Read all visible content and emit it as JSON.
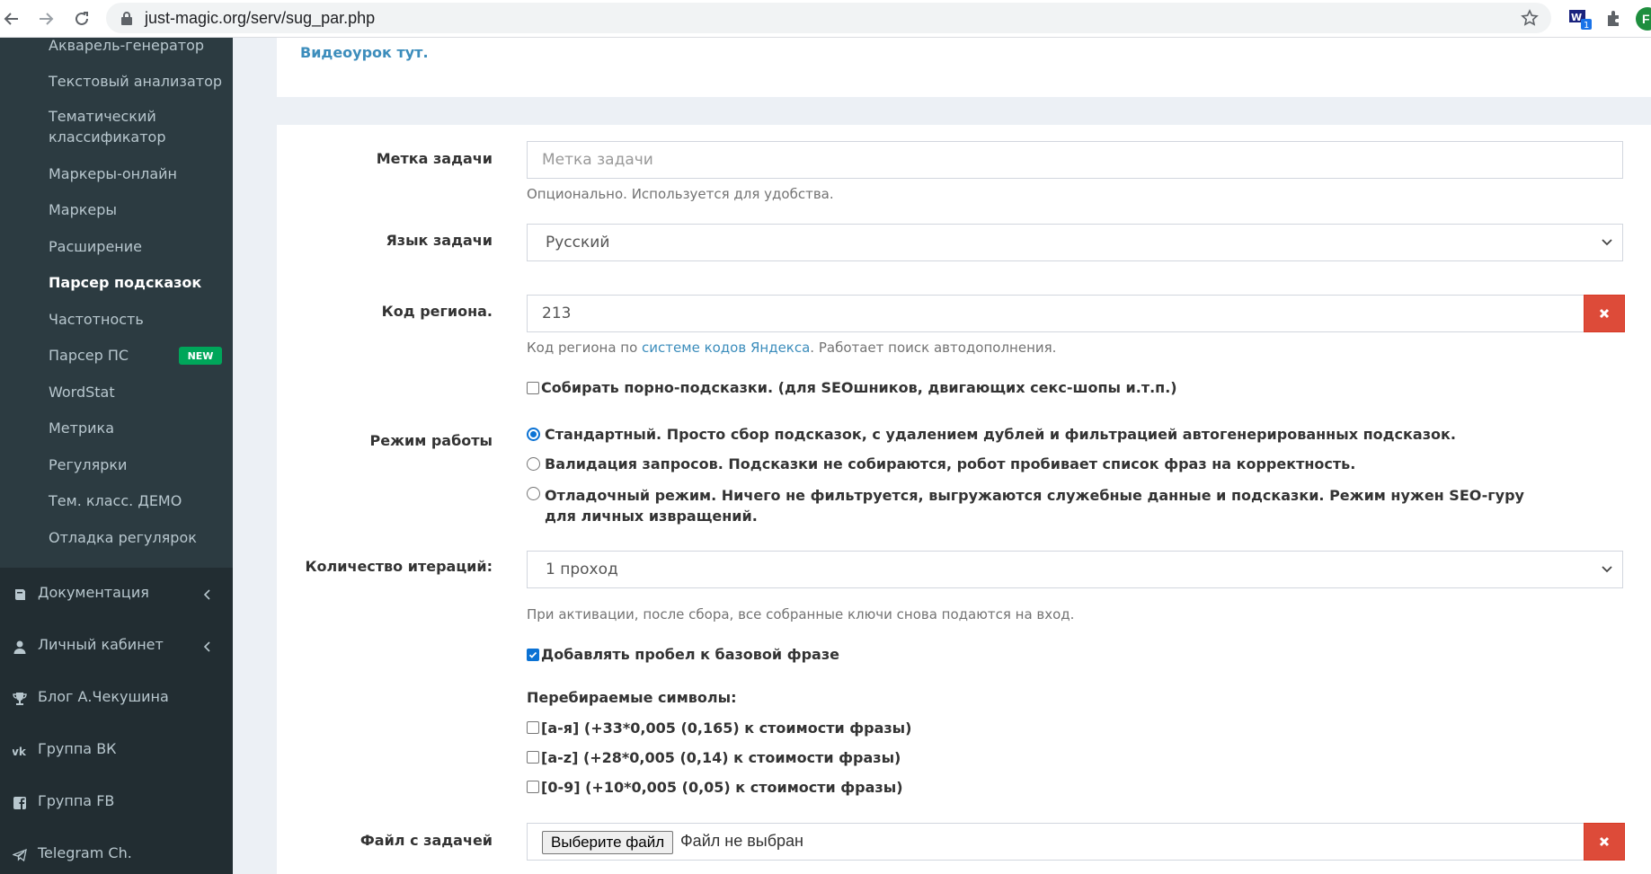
{
  "browser": {
    "url": "just-magic.org/serv/sug_par.php",
    "profile_initial": "F",
    "extension_badge": "1"
  },
  "sidebar": {
    "submenu": [
      {
        "label": "Акварель-генератор"
      },
      {
        "label": "Текстовый анализатор"
      },
      {
        "label": "Тематический классификатор"
      },
      {
        "label": "Маркеры-онлайн"
      },
      {
        "label": "Маркеры"
      },
      {
        "label": "Расширение"
      },
      {
        "label": "Парсер подсказок",
        "active": true
      },
      {
        "label": "Частотность"
      },
      {
        "label": "Парсер ПС",
        "badge": "NEW"
      },
      {
        "label": "WordStat"
      },
      {
        "label": "Метрика"
      },
      {
        "label": "Регулярки"
      },
      {
        "label": "Тем. класс. ДЕМО"
      },
      {
        "label": "Отладка регулярок"
      }
    ],
    "main": [
      {
        "label": "Документация",
        "icon": "book-icon"
      },
      {
        "label": "Личный кабинет",
        "icon": "user-icon"
      },
      {
        "label": "Блог А.Чекушина",
        "icon": "trophy-icon"
      },
      {
        "label": "Группа ВК",
        "icon": "vk-icon"
      },
      {
        "label": "Группа FB",
        "icon": "facebook-icon"
      },
      {
        "label": "Telegram Ch.",
        "icon": "telegram-icon"
      }
    ]
  },
  "top": {
    "video_link": "Видеоурок тут."
  },
  "form": {
    "task_label": {
      "label": "Метка задачи",
      "placeholder": "Метка задачи",
      "help": "Опционально. Используется для удобства."
    },
    "language": {
      "label": "Язык задачи",
      "value": "Русский"
    },
    "region": {
      "label": "Код региона.",
      "value": "213",
      "help_before": "Код региона по ",
      "help_link": "системе кодов Яндекса",
      "help_after": ". Работает поиск автодополнения."
    },
    "porn_checkbox": "Собирать порно-подсказки. (для SEOшников, двигающих секс-шопы и.т.п.)",
    "mode": {
      "label": "Режим работы",
      "options": [
        {
          "text": "Стандартный. Просто сбор подсказок, с удалением дублей и фильтрацией автогенерированных подсказок.",
          "checked": true
        },
        {
          "text": "Валидация запросов. Подсказки не собираются, робот пробивает список фраз на корректность.",
          "checked": false
        },
        {
          "text": "Отладочный режим. Ничего не фильтруется, выгружаются служебные данные и подсказки. Режим нужен SEO-гуру для личных извращений.",
          "checked": false
        }
      ]
    },
    "iterations": {
      "label": "Количество итераций:",
      "value": "1 проход",
      "help": "При активации, после сбора, все собранные ключи снова подаются на вход."
    },
    "space_checkbox": "Добавлять пробел к базовой фразе",
    "symbols": {
      "heading": "Перебираемые символы:",
      "options": [
        "[а-я] (+33*0,005 (0,165) к стоимости фразы)",
        "[a-z] (+28*0,005 (0,14) к стоимости фразы)",
        "[0-9] (+10*0,005 (0,05) к стоимости фразы)"
      ]
    },
    "file": {
      "label": "Файл с задачей",
      "button": "Выберите файл",
      "none": "Файл не выбран"
    }
  },
  "colors": {
    "sidebar_bg": "#222d32",
    "submenu_bg": "#2c3b41",
    "link": "#3c8dbc",
    "danger": "#dd4b39",
    "badge_new": "#00a65a"
  }
}
